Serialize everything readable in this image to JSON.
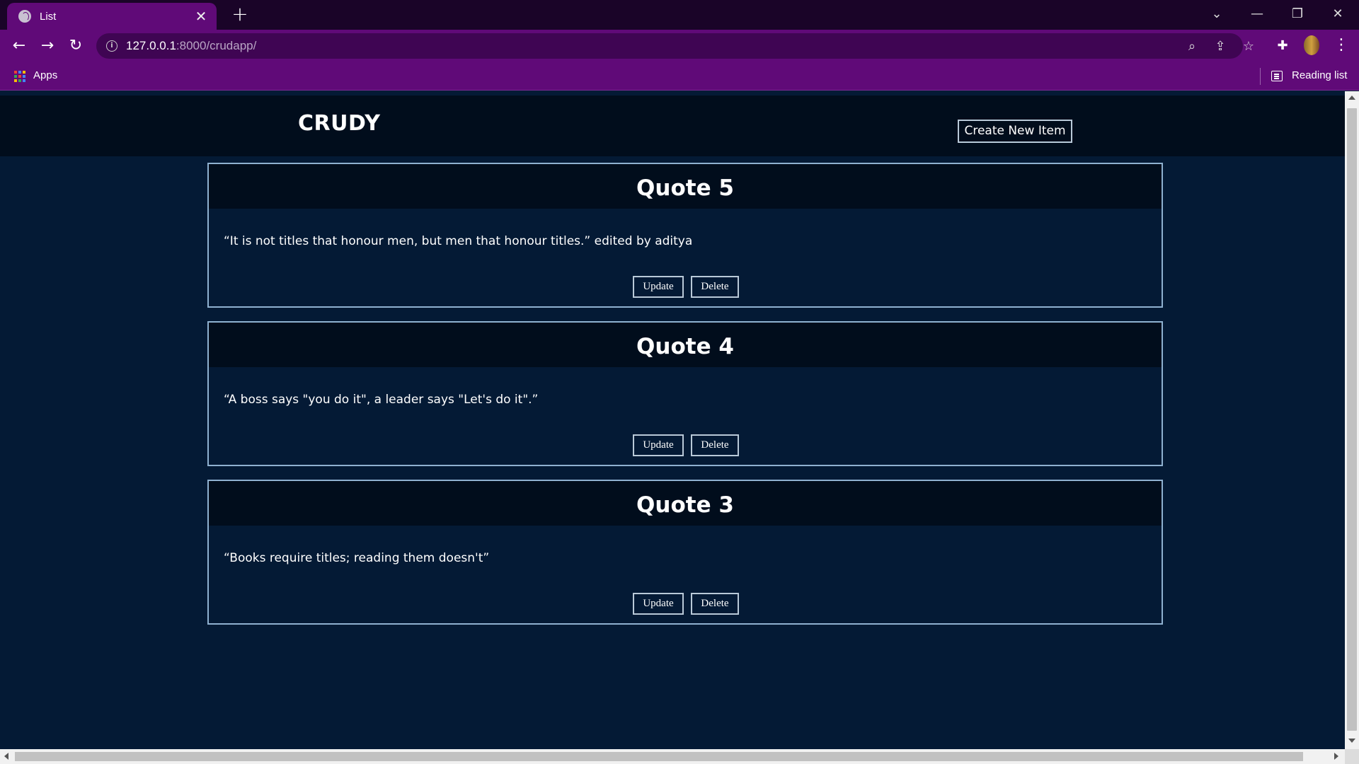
{
  "browser": {
    "tab_title": "List",
    "tab_close": "✕",
    "new_tab": "+",
    "url_host": "127.0.0.1",
    "url_path": ":8000/crudapp/",
    "bookmarks": {
      "apps_label": "Apps",
      "reading_list_label": "Reading list"
    },
    "colors": {
      "frame": "#600a78",
      "tabstrip": "#1a0428"
    }
  },
  "page": {
    "brand": "CRUDY",
    "create_button": "Create New Item",
    "quotes": [
      {
        "title": "Quote 5",
        "text": "“It is not titles that honour men, but men that honour titles.” edited by aditya",
        "update_label": "Update",
        "delete_label": "Delete"
      },
      {
        "title": "Quote 4",
        "text": "“A boss says \"you do it\", a leader says \"Let's do it\".”",
        "update_label": "Update",
        "delete_label": "Delete"
      },
      {
        "title": "Quote 3",
        "text": "“Books require titles; reading them doesn't”",
        "update_label": "Update",
        "delete_label": "Delete"
      }
    ],
    "colors": {
      "background": "#041a35",
      "header": "#010d1c",
      "card_border": "#8fb1d0"
    }
  }
}
